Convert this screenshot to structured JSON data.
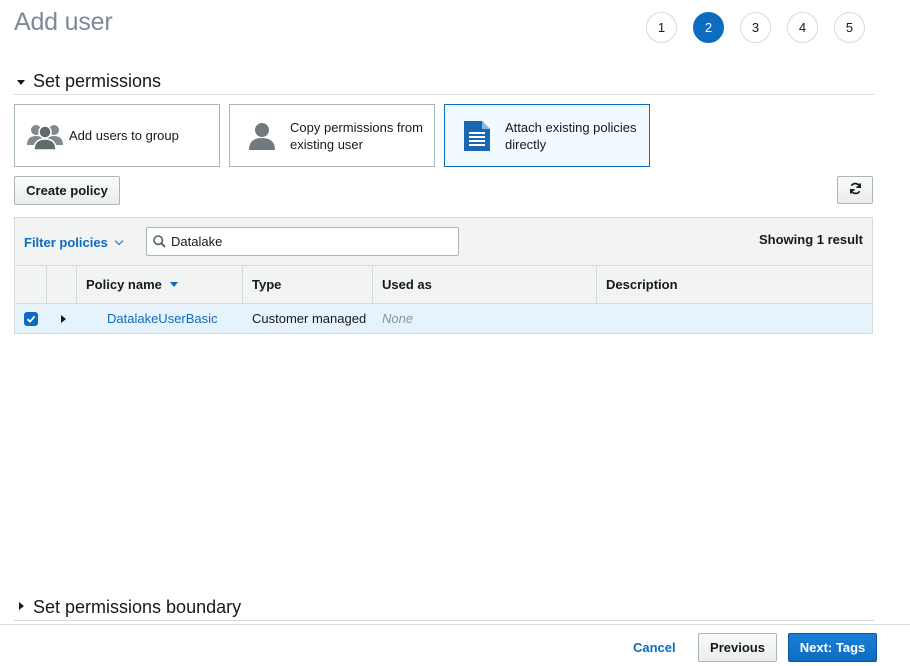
{
  "page": {
    "title": "Add user"
  },
  "steps": [
    "1",
    "2",
    "3",
    "4",
    "5"
  ],
  "active_step": "2",
  "set_permissions": {
    "title": "Set permissions",
    "options": [
      {
        "label": "Add users to group",
        "icon": "users-group-icon",
        "selected": false
      },
      {
        "label": "Copy permissions from existing user",
        "icon": "user-icon",
        "selected": false
      },
      {
        "label": "Attach existing policies directly",
        "icon": "document-icon",
        "selected": true
      }
    ]
  },
  "toolbar": {
    "create_policy_label": "Create policy",
    "refresh_icon": "refresh-icon"
  },
  "filter": {
    "filter_label": "Filter policies",
    "search_value": "Datalake",
    "showing_text": "Showing 1 result"
  },
  "table": {
    "columns": [
      "Policy name",
      "Type",
      "Used as",
      "Description"
    ],
    "rows": [
      {
        "checked": true,
        "policy_name": "DatalakeUserBasic",
        "type": "Customer managed",
        "used_as": "None",
        "description": ""
      }
    ]
  },
  "boundary": {
    "title": "Set permissions boundary"
  },
  "footer": {
    "cancel_label": "Cancel",
    "previous_label": "Previous",
    "next_label": "Next: Tags"
  },
  "colors": {
    "accent": "#0e6cc0",
    "selected_bg": "#f1faff",
    "row_selected_bg": "#e7f3fc",
    "border": "#d5dbdb"
  }
}
